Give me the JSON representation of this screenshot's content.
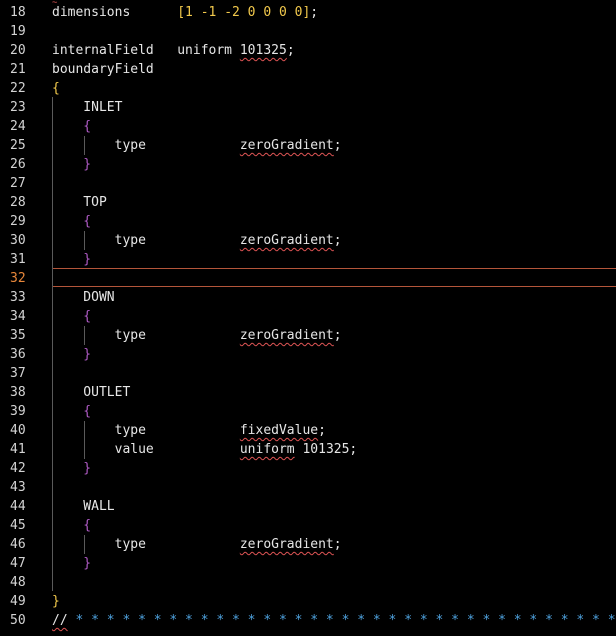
{
  "editor": {
    "language": "OpenFOAM dictionary",
    "current_line": "32",
    "colors": {
      "background": "#000000",
      "text": "#e6e6e6",
      "line_number": "#d4d4d4",
      "current_line_number": "#e8873a",
      "number": "#f2c94c",
      "brace_outer": "#f2c94c",
      "brace_inner": "#b15cc7",
      "comment": "#4fa3e0",
      "error_underline": "#e05555"
    },
    "lines": [
      {
        "num": "18",
        "tokens": [
          {
            "t": "dimensions      ",
            "c": "#e6e6e6"
          },
          {
            "t": "[1 -1 -2 0 0 0 0]",
            "c": "#f2c94c"
          },
          {
            "t": ";",
            "c": "#e6e6e6"
          }
        ]
      },
      {
        "num": "19",
        "tokens": []
      },
      {
        "num": "20",
        "tokens": [
          {
            "t": "internalField   uniform ",
            "c": "#e6e6e6"
          },
          {
            "t": "101325",
            "c": "#e6e6e6",
            "err": true
          },
          {
            "t": ";",
            "c": "#e6e6e6"
          }
        ]
      },
      {
        "num": "21",
        "tokens": [
          {
            "t": "boundaryField",
            "c": "#e6e6e6"
          }
        ]
      },
      {
        "num": "22",
        "tokens": [
          {
            "t": "{",
            "c": "#f2c94c"
          }
        ]
      },
      {
        "num": "23",
        "tokens": [
          {
            "t": "    INLET",
            "c": "#e6e6e6"
          }
        ]
      },
      {
        "num": "24",
        "tokens": [
          {
            "t": "    {",
            "c": "#b15cc7"
          }
        ]
      },
      {
        "num": "25",
        "tokens": [
          {
            "t": "        type            ",
            "c": "#e6e6e6"
          },
          {
            "t": "zeroGradient",
            "c": "#e6e6e6",
            "err": true
          },
          {
            "t": ";",
            "c": "#e6e6e6"
          }
        ]
      },
      {
        "num": "26",
        "tokens": [
          {
            "t": "    }",
            "c": "#b15cc7"
          }
        ]
      },
      {
        "num": "27",
        "tokens": []
      },
      {
        "num": "28",
        "tokens": [
          {
            "t": "    TOP",
            "c": "#e6e6e6"
          }
        ]
      },
      {
        "num": "29",
        "tokens": [
          {
            "t": "    {",
            "c": "#b15cc7"
          }
        ]
      },
      {
        "num": "30",
        "tokens": [
          {
            "t": "        type            ",
            "c": "#e6e6e6"
          },
          {
            "t": "zeroGradient",
            "c": "#e6e6e6",
            "err": true
          },
          {
            "t": ";",
            "c": "#e6e6e6"
          }
        ]
      },
      {
        "num": "31",
        "tokens": [
          {
            "t": "    }",
            "c": "#b15cc7"
          }
        ]
      },
      {
        "num": "32",
        "tokens": []
      },
      {
        "num": "33",
        "tokens": [
          {
            "t": "    DOWN",
            "c": "#e6e6e6"
          }
        ]
      },
      {
        "num": "34",
        "tokens": [
          {
            "t": "    {",
            "c": "#b15cc7"
          }
        ]
      },
      {
        "num": "35",
        "tokens": [
          {
            "t": "        type            ",
            "c": "#e6e6e6"
          },
          {
            "t": "zeroGradient",
            "c": "#e6e6e6",
            "err": true
          },
          {
            "t": ";",
            "c": "#e6e6e6"
          }
        ]
      },
      {
        "num": "36",
        "tokens": [
          {
            "t": "    }",
            "c": "#b15cc7"
          }
        ]
      },
      {
        "num": "37",
        "tokens": []
      },
      {
        "num": "38",
        "tokens": [
          {
            "t": "    OUTLET",
            "c": "#e6e6e6"
          }
        ]
      },
      {
        "num": "39",
        "tokens": [
          {
            "t": "    {",
            "c": "#b15cc7"
          }
        ]
      },
      {
        "num": "40",
        "tokens": [
          {
            "t": "        type            ",
            "c": "#e6e6e6"
          },
          {
            "t": "fixedValue",
            "c": "#e6e6e6",
            "err": true
          },
          {
            "t": ";",
            "c": "#e6e6e6"
          }
        ]
      },
      {
        "num": "41",
        "tokens": [
          {
            "t": "        value           ",
            "c": "#e6e6e6"
          },
          {
            "t": "uniform",
            "c": "#e6e6e6",
            "err": true
          },
          {
            "t": " 101325;",
            "c": "#e6e6e6"
          }
        ]
      },
      {
        "num": "42",
        "tokens": [
          {
            "t": "    }",
            "c": "#b15cc7"
          }
        ]
      },
      {
        "num": "43",
        "tokens": []
      },
      {
        "num": "44",
        "tokens": [
          {
            "t": "    WALL",
            "c": "#e6e6e6"
          }
        ]
      },
      {
        "num": "45",
        "tokens": [
          {
            "t": "    {",
            "c": "#b15cc7"
          }
        ]
      },
      {
        "num": "46",
        "tokens": [
          {
            "t": "        type            ",
            "c": "#e6e6e6"
          },
          {
            "t": "zeroGradient",
            "c": "#e6e6e6",
            "err": true
          },
          {
            "t": ";",
            "c": "#e6e6e6"
          }
        ]
      },
      {
        "num": "47",
        "tokens": [
          {
            "t": "    }",
            "c": "#b15cc7"
          }
        ]
      },
      {
        "num": "48",
        "tokens": []
      },
      {
        "num": "49",
        "tokens": [
          {
            "t": "}",
            "c": "#f2c94c"
          }
        ]
      },
      {
        "num": "50",
        "tokens": [
          {
            "t": "//",
            "c": "#e6e6e6",
            "err": true
          },
          {
            "t": " * * * * * * * * * * * * * * * * * * * * * * * * * * * * * * * * * * *",
            "c": "#4fa3e0"
          }
        ]
      }
    ]
  }
}
